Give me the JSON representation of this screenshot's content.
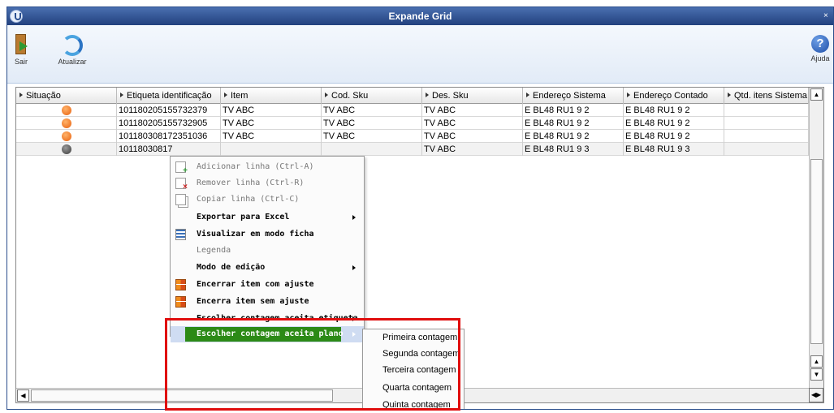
{
  "window": {
    "title": "Expande Grid",
    "close_glyph": "×"
  },
  "toolbar": {
    "sair_label": "Sair",
    "atualizar_label": "Atualizar",
    "ajuda_label": "Ajuda",
    "ajuda_glyph": "?"
  },
  "grid": {
    "columns": [
      "Situação",
      "Etiqueta identificação",
      "Item",
      "Cod. Sku",
      "Des. Sku",
      "Endereço Sistema",
      "Endereço Contado",
      "Qtd. itens Sistema"
    ],
    "rows": [
      {
        "status": "orange",
        "etiqueta": "101180205155732379",
        "item": "TV ABC",
        "cod_sku": "TV ABC",
        "des_sku": "TV ABC",
        "end_sistema": "E BL48 RU1 9 2",
        "end_contado": "E BL48 RU1 9 2",
        "qtd": ""
      },
      {
        "status": "orange",
        "etiqueta": "101180205155732905",
        "item": "TV ABC",
        "cod_sku": "TV ABC",
        "des_sku": "TV ABC",
        "end_sistema": "E BL48 RU1 9 2",
        "end_contado": "E BL48 RU1 9 2",
        "qtd": ""
      },
      {
        "status": "orange",
        "etiqueta": "101180308172351036",
        "item": "TV ABC",
        "cod_sku": "TV ABC",
        "des_sku": "TV ABC",
        "end_sistema": "E BL48 RU1 9 2",
        "end_contado": "E BL48 RU1 9 2",
        "qtd": ""
      },
      {
        "status": "dark",
        "etiqueta": "10118030817",
        "item": "",
        "cod_sku": "",
        "des_sku": "TV ABC",
        "end_sistema": "E BL48 RU1 9 3",
        "end_contado": "E BL48 RU1 9 3",
        "qtd": ""
      }
    ]
  },
  "context_menu": {
    "items": [
      {
        "label": "Adicionar linha (Ctrl-A)",
        "icon": "page-add-icon"
      },
      {
        "label": "Remover linha (Ctrl-R)",
        "icon": "page-remove-icon"
      },
      {
        "label": "Copiar linha (Ctrl-C)",
        "icon": "copy-icon"
      },
      {
        "label": "Exportar para Excel",
        "icon": ""
      },
      {
        "label": "Visualizar em modo ficha",
        "icon": "list-icon"
      },
      {
        "label": "Legenda",
        "icon": ""
      },
      {
        "label": "Modo de edição",
        "icon": ""
      },
      {
        "label": "Encerrar item com ajuste",
        "icon": "grid-close-icon"
      },
      {
        "label": "Encerra item sem ajuste",
        "icon": "grid-close-icon"
      },
      {
        "label": "Escolher contagem aceita etiqueta",
        "icon": ""
      },
      {
        "label": "Escolher contagem aceita plano",
        "icon": ""
      }
    ]
  },
  "submenu": {
    "items": [
      "Primeira contagem",
      "Segunda contagem",
      "Terceira contagem",
      "Quarta contagem",
      "Quinta contagem"
    ]
  },
  "colors": {
    "title_bar": "#22417e",
    "status_orange": "#e85f0c",
    "status_dark": "#3a3a3a",
    "menu_highlight": "#2c8a16",
    "annotation_box": "#e00d0d"
  }
}
